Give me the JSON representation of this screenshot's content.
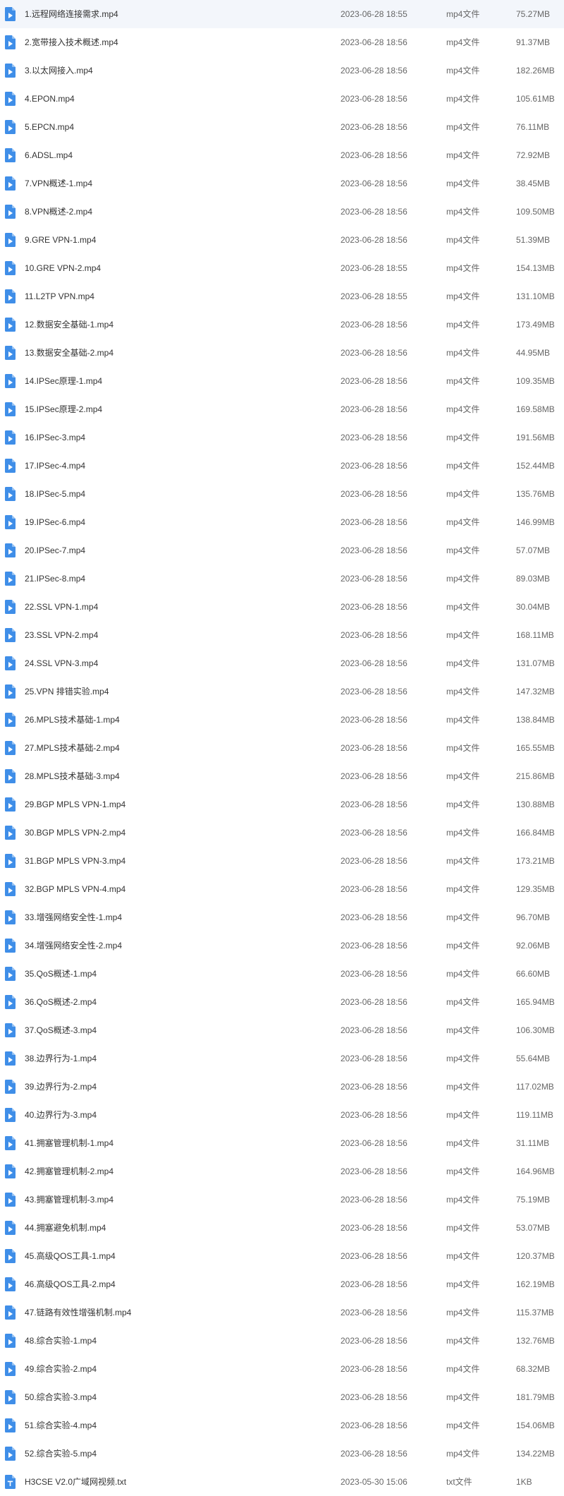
{
  "colors": {
    "video_icon": "#3f8ee8",
    "text_icon": "#3f8ee8",
    "icon_glyph": "#ffffff"
  },
  "files": [
    {
      "name": "1.远程网络连接需求.mp4",
      "date": "2023-06-28 18:55",
      "type": "mp4文件",
      "size": "75.27MB",
      "icon": "video-file-icon"
    },
    {
      "name": "2.宽带接入技术概述.mp4",
      "date": "2023-06-28 18:56",
      "type": "mp4文件",
      "size": "91.37MB",
      "icon": "video-file-icon"
    },
    {
      "name": "3.以太网接入.mp4",
      "date": "2023-06-28 18:56",
      "type": "mp4文件",
      "size": "182.26MB",
      "icon": "video-file-icon"
    },
    {
      "name": "4.EPON.mp4",
      "date": "2023-06-28 18:56",
      "type": "mp4文件",
      "size": "105.61MB",
      "icon": "video-file-icon"
    },
    {
      "name": "5.EPCN.mp4",
      "date": "2023-06-28 18:56",
      "type": "mp4文件",
      "size": "76.11MB",
      "icon": "video-file-icon"
    },
    {
      "name": "6.ADSL.mp4",
      "date": "2023-06-28 18:56",
      "type": "mp4文件",
      "size": "72.92MB",
      "icon": "video-file-icon"
    },
    {
      "name": "7.VPN概述-1.mp4",
      "date": "2023-06-28 18:56",
      "type": "mp4文件",
      "size": "38.45MB",
      "icon": "video-file-icon"
    },
    {
      "name": "8.VPN概述-2.mp4",
      "date": "2023-06-28 18:56",
      "type": "mp4文件",
      "size": "109.50MB",
      "icon": "video-file-icon"
    },
    {
      "name": "9.GRE VPN-1.mp4",
      "date": "2023-06-28 18:56",
      "type": "mp4文件",
      "size": "51.39MB",
      "icon": "video-file-icon"
    },
    {
      "name": "10.GRE VPN-2.mp4",
      "date": "2023-06-28 18:55",
      "type": "mp4文件",
      "size": "154.13MB",
      "icon": "video-file-icon"
    },
    {
      "name": "11.L2TP VPN.mp4",
      "date": "2023-06-28 18:55",
      "type": "mp4文件",
      "size": "131.10MB",
      "icon": "video-file-icon"
    },
    {
      "name": "12.数据安全基础-1.mp4",
      "date": "2023-06-28 18:56",
      "type": "mp4文件",
      "size": "173.49MB",
      "icon": "video-file-icon"
    },
    {
      "name": "13.数据安全基础-2.mp4",
      "date": "2023-06-28 18:56",
      "type": "mp4文件",
      "size": "44.95MB",
      "icon": "video-file-icon"
    },
    {
      "name": "14.IPSec原理-1.mp4",
      "date": "2023-06-28 18:56",
      "type": "mp4文件",
      "size": "109.35MB",
      "icon": "video-file-icon"
    },
    {
      "name": "15.IPSec原理-2.mp4",
      "date": "2023-06-28 18:56",
      "type": "mp4文件",
      "size": "169.58MB",
      "icon": "video-file-icon"
    },
    {
      "name": "16.IPSec-3.mp4",
      "date": "2023-06-28 18:56",
      "type": "mp4文件",
      "size": "191.56MB",
      "icon": "video-file-icon"
    },
    {
      "name": "17.IPSec-4.mp4",
      "date": "2023-06-28 18:56",
      "type": "mp4文件",
      "size": "152.44MB",
      "icon": "video-file-icon"
    },
    {
      "name": "18.IPSec-5.mp4",
      "date": "2023-06-28 18:56",
      "type": "mp4文件",
      "size": "135.76MB",
      "icon": "video-file-icon"
    },
    {
      "name": "19.IPSec-6.mp4",
      "date": "2023-06-28 18:56",
      "type": "mp4文件",
      "size": "146.99MB",
      "icon": "video-file-icon"
    },
    {
      "name": "20.IPSec-7.mp4",
      "date": "2023-06-28 18:56",
      "type": "mp4文件",
      "size": "57.07MB",
      "icon": "video-file-icon"
    },
    {
      "name": "21.IPSec-8.mp4",
      "date": "2023-06-28 18:56",
      "type": "mp4文件",
      "size": "89.03MB",
      "icon": "video-file-icon"
    },
    {
      "name": "22.SSL VPN-1.mp4",
      "date": "2023-06-28 18:56",
      "type": "mp4文件",
      "size": "30.04MB",
      "icon": "video-file-icon"
    },
    {
      "name": "23.SSL VPN-2.mp4",
      "date": "2023-06-28 18:56",
      "type": "mp4文件",
      "size": "168.11MB",
      "icon": "video-file-icon"
    },
    {
      "name": "24.SSL VPN-3.mp4",
      "date": "2023-06-28 18:56",
      "type": "mp4文件",
      "size": "131.07MB",
      "icon": "video-file-icon"
    },
    {
      "name": "25.VPN 排错实验.mp4",
      "date": "2023-06-28 18:56",
      "type": "mp4文件",
      "size": "147.32MB",
      "icon": "video-file-icon"
    },
    {
      "name": "26.MPLS技术基础-1.mp4",
      "date": "2023-06-28 18:56",
      "type": "mp4文件",
      "size": "138.84MB",
      "icon": "video-file-icon"
    },
    {
      "name": "27.MPLS技术基础-2.mp4",
      "date": "2023-06-28 18:56",
      "type": "mp4文件",
      "size": "165.55MB",
      "icon": "video-file-icon"
    },
    {
      "name": "28.MPLS技术基础-3.mp4",
      "date": "2023-06-28 18:56",
      "type": "mp4文件",
      "size": "215.86MB",
      "icon": "video-file-icon"
    },
    {
      "name": "29.BGP MPLS VPN-1.mp4",
      "date": "2023-06-28 18:56",
      "type": "mp4文件",
      "size": "130.88MB",
      "icon": "video-file-icon"
    },
    {
      "name": "30.BGP MPLS VPN-2.mp4",
      "date": "2023-06-28 18:56",
      "type": "mp4文件",
      "size": "166.84MB",
      "icon": "video-file-icon"
    },
    {
      "name": "31.BGP MPLS VPN-3.mp4",
      "date": "2023-06-28 18:56",
      "type": "mp4文件",
      "size": "173.21MB",
      "icon": "video-file-icon"
    },
    {
      "name": "32.BGP MPLS VPN-4.mp4",
      "date": "2023-06-28 18:56",
      "type": "mp4文件",
      "size": "129.35MB",
      "icon": "video-file-icon"
    },
    {
      "name": "33.增强网络安全性-1.mp4",
      "date": "2023-06-28 18:56",
      "type": "mp4文件",
      "size": "96.70MB",
      "icon": "video-file-icon"
    },
    {
      "name": "34.增强网络安全性-2.mp4",
      "date": "2023-06-28 18:56",
      "type": "mp4文件",
      "size": "92.06MB",
      "icon": "video-file-icon"
    },
    {
      "name": "35.QoS概述-1.mp4",
      "date": "2023-06-28 18:56",
      "type": "mp4文件",
      "size": "66.60MB",
      "icon": "video-file-icon"
    },
    {
      "name": "36.QoS概述-2.mp4",
      "date": "2023-06-28 18:56",
      "type": "mp4文件",
      "size": "165.94MB",
      "icon": "video-file-icon"
    },
    {
      "name": "37.QoS概述-3.mp4",
      "date": "2023-06-28 18:56",
      "type": "mp4文件",
      "size": "106.30MB",
      "icon": "video-file-icon"
    },
    {
      "name": "38.边界行为-1.mp4",
      "date": "2023-06-28 18:56",
      "type": "mp4文件",
      "size": "55.64MB",
      "icon": "video-file-icon"
    },
    {
      "name": "39.边界行为-2.mp4",
      "date": "2023-06-28 18:56",
      "type": "mp4文件",
      "size": "117.02MB",
      "icon": "video-file-icon"
    },
    {
      "name": "40.边界行为-3.mp4",
      "date": "2023-06-28 18:56",
      "type": "mp4文件",
      "size": "119.11MB",
      "icon": "video-file-icon"
    },
    {
      "name": "41.拥塞管理机制-1.mp4",
      "date": "2023-06-28 18:56",
      "type": "mp4文件",
      "size": "31.11MB",
      "icon": "video-file-icon"
    },
    {
      "name": "42.拥塞管理机制-2.mp4",
      "date": "2023-06-28 18:56",
      "type": "mp4文件",
      "size": "164.96MB",
      "icon": "video-file-icon"
    },
    {
      "name": "43.拥塞管理机制-3.mp4",
      "date": "2023-06-28 18:56",
      "type": "mp4文件",
      "size": "75.19MB",
      "icon": "video-file-icon"
    },
    {
      "name": "44.拥塞避免机制.mp4",
      "date": "2023-06-28 18:56",
      "type": "mp4文件",
      "size": "53.07MB",
      "icon": "video-file-icon"
    },
    {
      "name": "45.高级QOS工具-1.mp4",
      "date": "2023-06-28 18:56",
      "type": "mp4文件",
      "size": "120.37MB",
      "icon": "video-file-icon"
    },
    {
      "name": "46.高级QOS工具-2.mp4",
      "date": "2023-06-28 18:56",
      "type": "mp4文件",
      "size": "162.19MB",
      "icon": "video-file-icon"
    },
    {
      "name": "47.链路有效性增强机制.mp4",
      "date": "2023-06-28 18:56",
      "type": "mp4文件",
      "size": "115.37MB",
      "icon": "video-file-icon"
    },
    {
      "name": "48.综合实验-1.mp4",
      "date": "2023-06-28 18:56",
      "type": "mp4文件",
      "size": "132.76MB",
      "icon": "video-file-icon"
    },
    {
      "name": "49.综合实验-2.mp4",
      "date": "2023-06-28 18:56",
      "type": "mp4文件",
      "size": "68.32MB",
      "icon": "video-file-icon"
    },
    {
      "name": "50.综合实验-3.mp4",
      "date": "2023-06-28 18:56",
      "type": "mp4文件",
      "size": "181.79MB",
      "icon": "video-file-icon"
    },
    {
      "name": "51.综合实验-4.mp4",
      "date": "2023-06-28 18:56",
      "type": "mp4文件",
      "size": "154.06MB",
      "icon": "video-file-icon"
    },
    {
      "name": "52.综合实验-5.mp4",
      "date": "2023-06-28 18:56",
      "type": "mp4文件",
      "size": "134.22MB",
      "icon": "video-file-icon"
    },
    {
      "name": "H3CSE V2.0广域网视频.txt",
      "date": "2023-05-30 15:06",
      "type": "txt文件",
      "size": "1KB",
      "icon": "text-file-icon"
    }
  ]
}
